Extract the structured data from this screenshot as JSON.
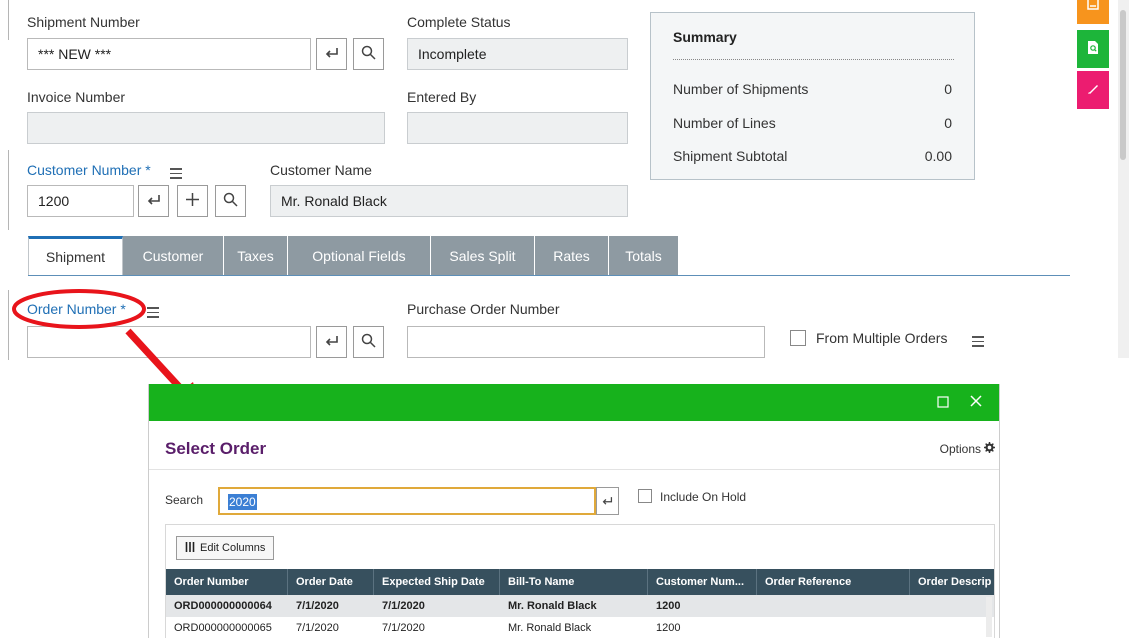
{
  "shipment": {
    "label": "Shipment Number",
    "value": "*** NEW ***"
  },
  "complete_status": {
    "label": "Complete Status",
    "value": "Incomplete"
  },
  "invoice": {
    "label": "Invoice Number",
    "value": ""
  },
  "entered_by": {
    "label": "Entered By",
    "value": ""
  },
  "customer_number": {
    "label": "Customer Number *",
    "value": "1200"
  },
  "customer_name": {
    "label": "Customer Name",
    "value": "Mr. Ronald Black"
  },
  "summary": {
    "title": "Summary",
    "rows": [
      {
        "label": "Number of Shipments",
        "value": "0"
      },
      {
        "label": "Number of Lines",
        "value": "0"
      },
      {
        "label": "Shipment Subtotal",
        "value": "0.00"
      }
    ]
  },
  "tabs": [
    "Shipment",
    "Customer",
    "Taxes",
    "Optional Fields",
    "Sales Split",
    "Rates",
    "Totals"
  ],
  "order_number": {
    "label": "Order Number *",
    "value": ""
  },
  "po_number": {
    "label": "Purchase Order Number",
    "value": ""
  },
  "from_multiple": {
    "label": "From Multiple Orders"
  },
  "toolbar_colors": {
    "orange": "#f7941d",
    "green": "#1db53a",
    "pink": "#ec1c70"
  },
  "annotation_color": "#e8141b",
  "dialog": {
    "title": "Select Order",
    "options_label": "Options",
    "search_label": "Search",
    "search_value": "2020",
    "include_on_hold_label": "Include On Hold",
    "edit_columns_label": "Edit Columns",
    "columns": [
      "Order Number",
      "Order Date",
      "Expected Ship Date",
      "Bill-To Name",
      "Customer Num...",
      "Order Reference",
      "Order Descrip"
    ],
    "rows": [
      [
        "ORD000000000064",
        "7/1/2020",
        "7/1/2020",
        "Mr. Ronald Black",
        "1200",
        "",
        ""
      ],
      [
        "ORD000000000065",
        "7/1/2020",
        "7/1/2020",
        "Mr. Ronald Black",
        "1200",
        "",
        ""
      ]
    ],
    "bar_color": "#17b21c"
  }
}
